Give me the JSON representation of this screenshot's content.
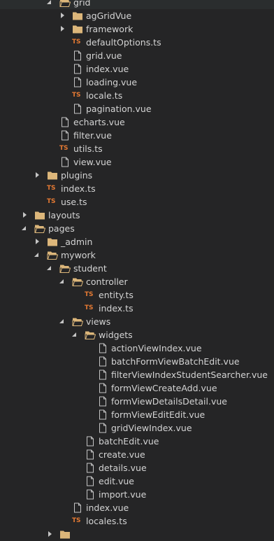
{
  "tree": [
    {
      "label": "grid",
      "type": "folder-open",
      "depth": 4
    },
    {
      "label": "agGridVue",
      "type": "folder-closed",
      "depth": 5
    },
    {
      "label": "framework",
      "type": "folder-closed",
      "depth": 5
    },
    {
      "label": "defaultOptions.ts",
      "type": "ts",
      "depth": 5
    },
    {
      "label": "grid.vue",
      "type": "file",
      "depth": 5
    },
    {
      "label": "index.vue",
      "type": "file",
      "depth": 5
    },
    {
      "label": "loading.vue",
      "type": "file",
      "depth": 5
    },
    {
      "label": "locale.ts",
      "type": "ts",
      "depth": 5
    },
    {
      "label": "pagination.vue",
      "type": "file",
      "depth": 5
    },
    {
      "label": "echarts.vue",
      "type": "file",
      "depth": 4
    },
    {
      "label": "filter.vue",
      "type": "file",
      "depth": 4
    },
    {
      "label": "utils.ts",
      "type": "ts",
      "depth": 4
    },
    {
      "label": "view.vue",
      "type": "file",
      "depth": 4
    },
    {
      "label": "plugins",
      "type": "folder-closed",
      "depth": 3
    },
    {
      "label": "index.ts",
      "type": "ts",
      "depth": 3
    },
    {
      "label": "use.ts",
      "type": "ts",
      "depth": 3
    },
    {
      "label": "layouts",
      "type": "folder-closed",
      "depth": 2
    },
    {
      "label": "pages",
      "type": "folder-open",
      "depth": 2
    },
    {
      "label": "_admin",
      "type": "folder-closed",
      "depth": 3
    },
    {
      "label": "mywork",
      "type": "folder-open",
      "depth": 3
    },
    {
      "label": "student",
      "type": "folder-open",
      "depth": 4
    },
    {
      "label": "controller",
      "type": "folder-open",
      "depth": 5
    },
    {
      "label": "entity.ts",
      "type": "ts",
      "depth": 6
    },
    {
      "label": "index.ts",
      "type": "ts",
      "depth": 6
    },
    {
      "label": "views",
      "type": "folder-open",
      "depth": 5
    },
    {
      "label": "widgets",
      "type": "folder-open",
      "depth": 6
    },
    {
      "label": "actionViewIndex.vue",
      "type": "file",
      "depth": 7
    },
    {
      "label": "batchFormViewBatchEdit.vue",
      "type": "file",
      "depth": 7
    },
    {
      "label": "filterViewIndexStudentSearcher.vue",
      "type": "file",
      "depth": 7
    },
    {
      "label": "formViewCreateAdd.vue",
      "type": "file",
      "depth": 7
    },
    {
      "label": "formViewDetailsDetail.vue",
      "type": "file",
      "depth": 7
    },
    {
      "label": "formViewEditEdit.vue",
      "type": "file",
      "depth": 7
    },
    {
      "label": "gridViewIndex.vue",
      "type": "file",
      "depth": 7
    },
    {
      "label": "batchEdit.vue",
      "type": "file",
      "depth": 6
    },
    {
      "label": "create.vue",
      "type": "file",
      "depth": 6
    },
    {
      "label": "details.vue",
      "type": "file",
      "depth": 6
    },
    {
      "label": "edit.vue",
      "type": "file",
      "depth": 6
    },
    {
      "label": "import.vue",
      "type": "file",
      "depth": 6
    },
    {
      "label": "index.vue",
      "type": "file",
      "depth": 5
    },
    {
      "label": "locales.ts",
      "type": "ts",
      "depth": 5
    },
    {
      "label": "",
      "type": "folder-closed",
      "depth": 4
    }
  ],
  "icons": {
    "folder-open": "folder-open-icon",
    "folder-closed": "folder-icon",
    "file": "file-icon",
    "ts": "typescript-file-icon"
  },
  "ts_badge": "TS",
  "colors": {
    "background": "#252526",
    "text": "#d4d4d4",
    "folder": "#dcb67a",
    "ts": "#e37933",
    "file_outline": "#c5c5c5"
  }
}
